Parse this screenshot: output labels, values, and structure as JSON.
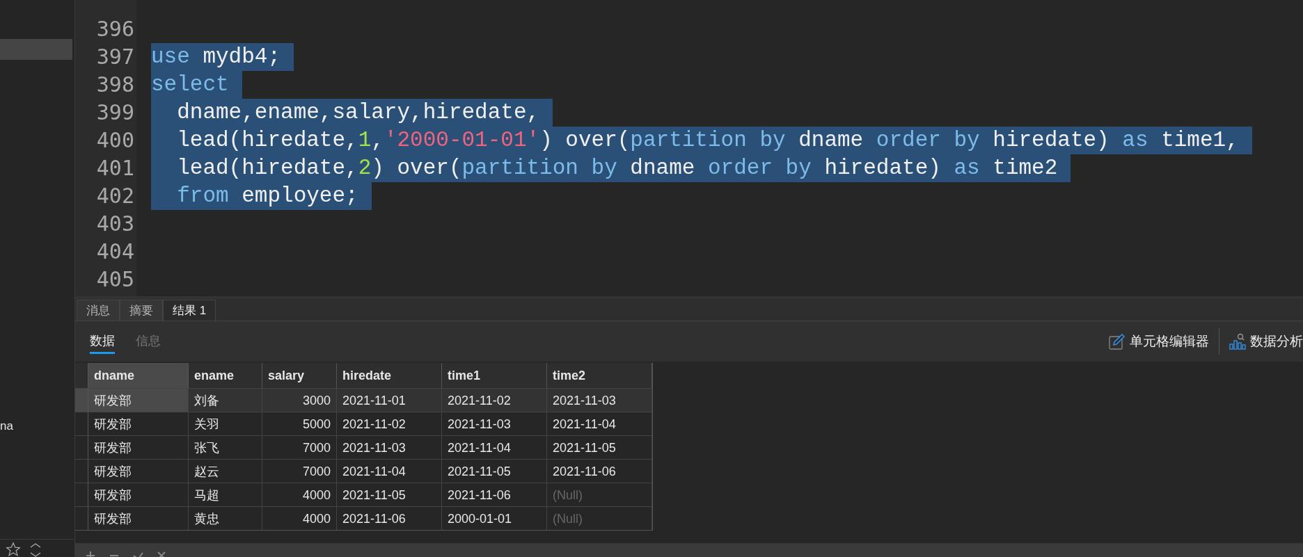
{
  "sidebar": {
    "items": [
      {
        "selected": true
      },
      {
        "label": "na",
        "selected": false
      }
    ]
  },
  "editor": {
    "lines": [
      {
        "number": "396"
      },
      {
        "number": "397",
        "selected": true,
        "tokens": [
          {
            "kind": "keyword",
            "text": "use"
          },
          {
            "kind": "plain",
            "text": " mydb4;"
          }
        ]
      },
      {
        "number": "398",
        "selected": true,
        "tokens": [
          {
            "kind": "keyword",
            "text": "select"
          }
        ]
      },
      {
        "number": "399",
        "selected": true,
        "tokens": [
          {
            "kind": "plain",
            "text": "  dname,ename,salary,hiredate,"
          }
        ]
      },
      {
        "number": "400",
        "selected": true,
        "tokens": [
          {
            "kind": "plain",
            "text": "  lead(hiredate,"
          },
          {
            "kind": "number",
            "text": "1"
          },
          {
            "kind": "plain",
            "text": ","
          },
          {
            "kind": "string",
            "text": "'2000-01-01'"
          },
          {
            "kind": "plain",
            "text": ") over("
          },
          {
            "kind": "keyword",
            "text": "partition by"
          },
          {
            "kind": "plain",
            "text": " dname "
          },
          {
            "kind": "keyword",
            "text": "order by"
          },
          {
            "kind": "plain",
            "text": " hiredate) "
          },
          {
            "kind": "keyword",
            "text": "as"
          },
          {
            "kind": "plain",
            "text": " time1,"
          }
        ]
      },
      {
        "number": "401",
        "selected": true,
        "tokens": [
          {
            "kind": "plain",
            "text": "  lead(hiredate,"
          },
          {
            "kind": "number",
            "text": "2"
          },
          {
            "kind": "plain",
            "text": ") over("
          },
          {
            "kind": "keyword",
            "text": "partition by"
          },
          {
            "kind": "plain",
            "text": " dname "
          },
          {
            "kind": "keyword",
            "text": "order by"
          },
          {
            "kind": "plain",
            "text": " hiredate) "
          },
          {
            "kind": "keyword",
            "text": "as"
          },
          {
            "kind": "plain",
            "text": " time2"
          }
        ]
      },
      {
        "number": "402",
        "selected": true,
        "tokens": [
          {
            "kind": "keyword",
            "text": "  from"
          },
          {
            "kind": "plain",
            "text": " employee;"
          }
        ]
      },
      {
        "number": "403"
      },
      {
        "number": "404"
      },
      {
        "number": "405"
      }
    ]
  },
  "result_tabs": [
    {
      "label": "消息",
      "selected": false
    },
    {
      "label": "摘要",
      "selected": false
    },
    {
      "label": "结果 1",
      "selected": true
    }
  ],
  "sub_tabs": [
    {
      "label": "数据",
      "selected": true
    },
    {
      "label": "信息",
      "selected": false
    }
  ],
  "toolbar": [
    {
      "kind": "edit",
      "label": "单元格编辑器"
    },
    {
      "kind": "analysis",
      "label": "数据分析"
    }
  ],
  "table": {
    "columns": [
      {
        "label": "dname",
        "numeric": false,
        "selected": true
      },
      {
        "label": "ename",
        "numeric": false,
        "selected": false
      },
      {
        "label": "salary",
        "numeric": true,
        "selected": false
      },
      {
        "label": "hiredate",
        "numeric": false,
        "selected": false
      },
      {
        "label": "time1",
        "numeric": false,
        "selected": false
      },
      {
        "label": "time2",
        "numeric": false,
        "selected": false
      }
    ],
    "rows": [
      {
        "selected": true,
        "cells": [
          {
            "text": "研发部",
            "null": false
          },
          {
            "text": "刘备",
            "null": false
          },
          {
            "text": "3000",
            "null": false
          },
          {
            "text": "2021-11-01",
            "null": false
          },
          {
            "text": "2021-11-02",
            "null": false
          },
          {
            "text": "2021-11-03",
            "null": false
          }
        ]
      },
      {
        "selected": false,
        "cells": [
          {
            "text": "研发部",
            "null": false
          },
          {
            "text": "关羽",
            "null": false
          },
          {
            "text": "5000",
            "null": false
          },
          {
            "text": "2021-11-02",
            "null": false
          },
          {
            "text": "2021-11-03",
            "null": false
          },
          {
            "text": "2021-11-04",
            "null": false
          }
        ]
      },
      {
        "selected": false,
        "cells": [
          {
            "text": "研发部",
            "null": false
          },
          {
            "text": "张飞",
            "null": false
          },
          {
            "text": "7000",
            "null": false
          },
          {
            "text": "2021-11-03",
            "null": false
          },
          {
            "text": "2021-11-04",
            "null": false
          },
          {
            "text": "2021-11-05",
            "null": false
          }
        ]
      },
      {
        "selected": false,
        "cells": [
          {
            "text": "研发部",
            "null": false
          },
          {
            "text": "赵云",
            "null": false
          },
          {
            "text": "7000",
            "null": false
          },
          {
            "text": "2021-11-04",
            "null": false
          },
          {
            "text": "2021-11-05",
            "null": false
          },
          {
            "text": "2021-11-06",
            "null": false
          }
        ]
      },
      {
        "selected": false,
        "cells": [
          {
            "text": "研发部",
            "null": false
          },
          {
            "text": "马超",
            "null": false
          },
          {
            "text": "4000",
            "null": false
          },
          {
            "text": "2021-11-05",
            "null": false
          },
          {
            "text": "2021-11-06",
            "null": false
          },
          {
            "text": "(Null)",
            "null": true
          }
        ]
      },
      {
        "selected": false,
        "cells": [
          {
            "text": "研发部",
            "null": false
          },
          {
            "text": "黄忠",
            "null": false
          },
          {
            "text": "4000",
            "null": false
          },
          {
            "text": "2021-11-06",
            "null": false
          },
          {
            "text": "2000-01-01",
            "null": false
          },
          {
            "text": "(Null)",
            "null": true
          }
        ]
      }
    ]
  }
}
